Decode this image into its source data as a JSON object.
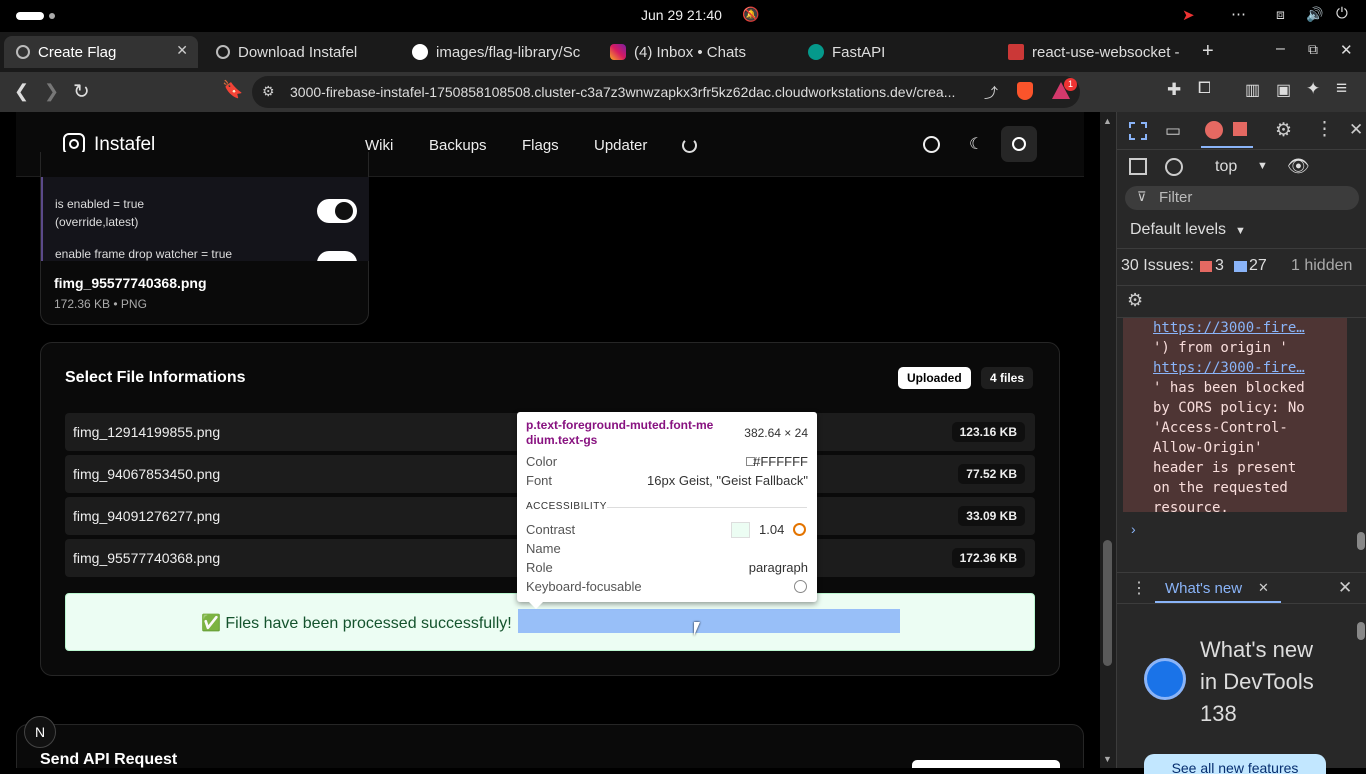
{
  "os": {
    "date_time": "Jun 29  21:40"
  },
  "tabs": [
    {
      "title": "Create Flag",
      "active": true
    },
    {
      "title": "Download Instafel",
      "active": false
    },
    {
      "title": "images/flag-library/Sc",
      "active": false
    },
    {
      "title": "(4) Inbox • Chats",
      "active": false
    },
    {
      "title": "FastAPI",
      "active": false
    },
    {
      "title": "react-use-websocket -",
      "active": false
    }
  ],
  "address": {
    "url": "3000-firebase-instafel-1750858108508.cluster-c3a7z3wnwzapkx3rfr5kz62dac.cloudworkstations.dev/crea...",
    "brave_badge": "1"
  },
  "site": {
    "brand": "Instafel",
    "nav": [
      "Wiki",
      "Backups",
      "Flags",
      "Updater"
    ]
  },
  "preview": {
    "toggle1_label": "is enabled = true\n(override,latest)",
    "toggle2_label": "enable frame drop watcher = true",
    "file_name": "fimg_95577740368.png",
    "file_meta": "172.36 KB • PNG"
  },
  "file_info": {
    "title": "Select File Informations",
    "badge_uploaded": "Uploaded",
    "badge_count": "4 files",
    "files": [
      {
        "name": "fimg_12914199855.png",
        "size": "123.16 KB"
      },
      {
        "name": "fimg_94067853450.png",
        "size": "77.52 KB"
      },
      {
        "name": "fimg_94091276277.png",
        "size": "33.09 KB"
      },
      {
        "name": "fimg_95577740368.png",
        "size": "172.36 KB"
      }
    ],
    "success": "✅ Files have been processed successfully!"
  },
  "api": {
    "title": "Send API Request"
  },
  "tooltip": {
    "selector": "p.text-foreground-muted.font-me\ndium.text-gs",
    "dims": "382.64 × 24",
    "color_label": "Color",
    "color_value": "#FFFFFF",
    "font_label": "Font",
    "font_value": "16px Geist, \"Geist Fallback\"",
    "section": "ACCESSIBILITY",
    "contrast_label": "Contrast",
    "contrast_value": "1.04",
    "name_label": "Name",
    "role_label": "Role",
    "role_value": "paragraph",
    "kbd_label": "Keyboard-focusable"
  },
  "devtools": {
    "context": "top",
    "filter_placeholder": "Filter",
    "levels": "Default levels",
    "issues_label": "30 Issues:",
    "errors": "3",
    "infos": "27",
    "hidden": "1 hidden",
    "console_lines": [
      "https://3000-fire…",
      "') from origin '",
      "https://3000-fire…",
      "' has been blocked",
      "by CORS policy: No",
      "'Access-Control-",
      "Allow-Origin'",
      "header is present",
      "on the requested",
      "resource."
    ],
    "drawer_tab": "What's new",
    "whats_new_title": "What's new\nin DevTools\n138",
    "see_all": "See all new features"
  },
  "colors": {
    "success_bg": "#ecfdf3",
    "success_text": "#14532d",
    "highlight": "#8ab4f8"
  }
}
